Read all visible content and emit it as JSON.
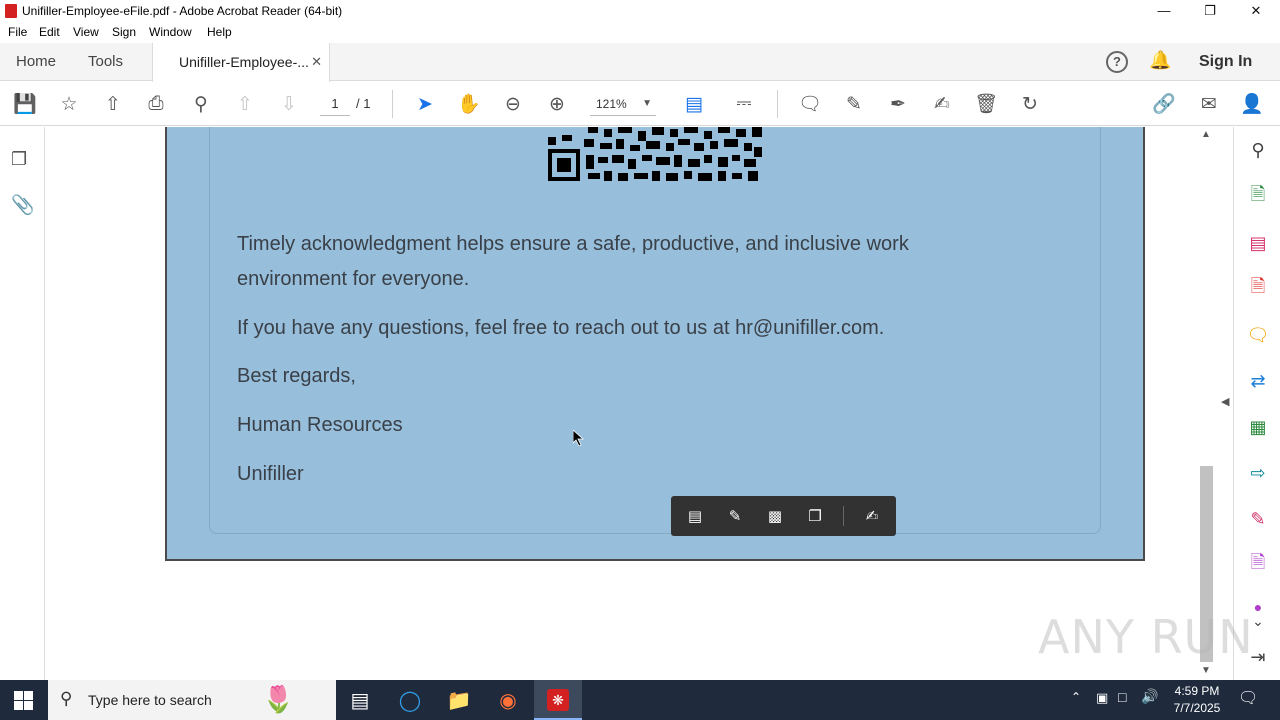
{
  "window": {
    "title": "Unifiller-Employee-eFile.pdf - Adobe Acrobat Reader (64-bit)"
  },
  "menu": [
    "File",
    "Edit",
    "View",
    "Sign",
    "Window",
    "Help"
  ],
  "tabs": {
    "home": "Home",
    "tools": "Tools",
    "document": "Unifiller-Employee-...",
    "sign_in": "Sign In"
  },
  "toolbar": {
    "page_current": "1",
    "page_total": "/ 1",
    "zoom": "121%"
  },
  "document": {
    "paragraph1": "Timely acknowledgment helps ensure a safe, productive, and inclusive work",
    "paragraph1b": "environment for everyone.",
    "paragraph2": "If you have any questions, feel free to reach out to us at hr@unifiller.com.",
    "closing": "Best regards,",
    "department": "Human Resources",
    "company": "Unifiller"
  },
  "taskbar": {
    "search_placeholder": "Type here to search",
    "time": "4:59 PM",
    "date": "7/7/2025"
  },
  "watermark": "ANY RUN",
  "colors": {
    "page_bg": "#97bedb",
    "accent": "#1a73e8",
    "acrobat_red": "#d32020"
  }
}
